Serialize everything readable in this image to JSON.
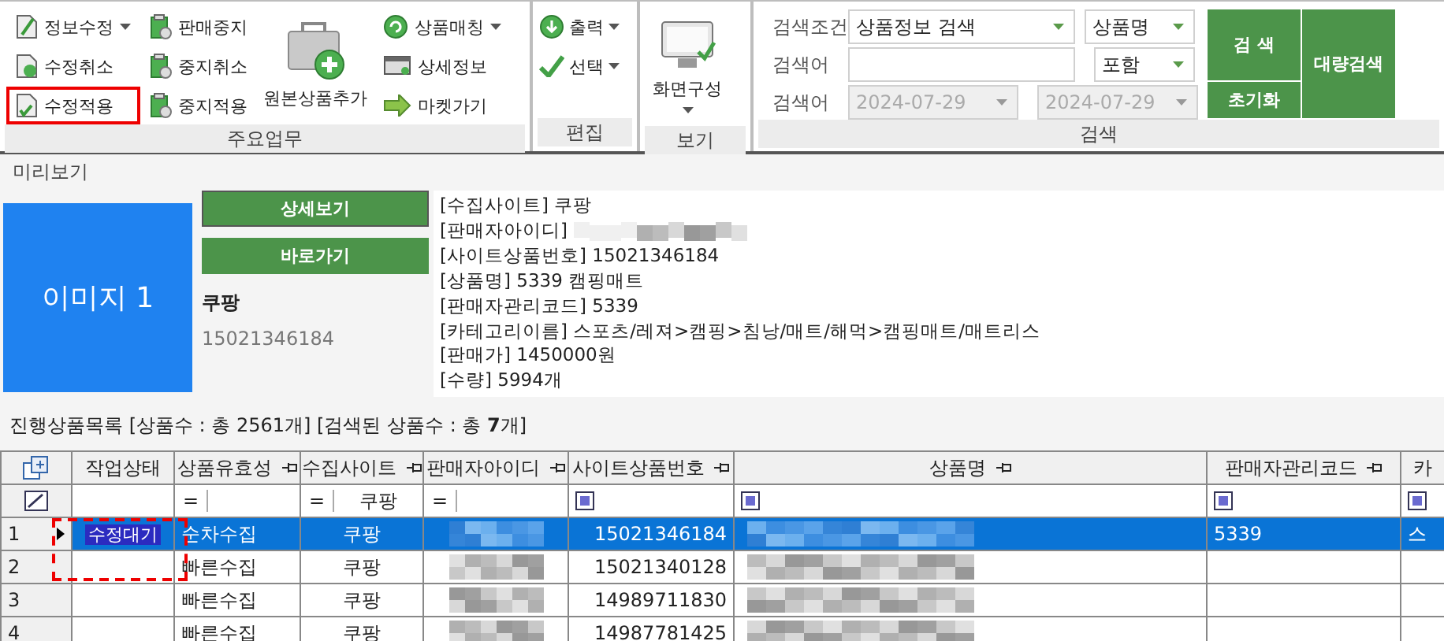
{
  "ribbon": {
    "main_tasks": {
      "label": "주요업무",
      "columns": [
        [
          {
            "label": "정보수정",
            "dropdown": true,
            "highlighted": false
          },
          {
            "label": "수정취소",
            "dropdown": false,
            "highlighted": false
          },
          {
            "label": "수정적용",
            "dropdown": false,
            "highlighted": true
          }
        ],
        [
          {
            "label": "판매중지",
            "dropdown": false,
            "highlighted": false
          },
          {
            "label": "중지취소",
            "dropdown": false,
            "highlighted": false
          },
          {
            "label": "중지적용",
            "dropdown": false,
            "highlighted": false
          }
        ],
        [
          {
            "label": "원본상품추가",
            "highlighted": false
          }
        ],
        [
          {
            "label": "상품매칭",
            "dropdown": true,
            "highlighted": false
          },
          {
            "label": "상세정보",
            "dropdown": false,
            "highlighted": false
          },
          {
            "label": "마켓가기",
            "dropdown": false,
            "highlighted": false
          }
        ]
      ]
    },
    "edit": {
      "label": "편집",
      "buttons": [
        {
          "label": "출력",
          "dropdown": true
        },
        {
          "label": "선택",
          "dropdown": true
        }
      ]
    },
    "view": {
      "label": "보기",
      "button": {
        "label": "화면구성",
        "dropdown": true
      }
    },
    "search": {
      "label": "검색",
      "condition_label": "검색조건",
      "condition": "상품정보 검색",
      "field": "상품명",
      "keyword_label": "검색어",
      "match": "포함",
      "date_label": "검색어",
      "date_from": "2024-07-29",
      "date_to": "2024-07-29",
      "dates_disabled": true,
      "search_button": "검 색",
      "reset_button": "초기화",
      "bulk_button": "대량검색"
    }
  },
  "preview": {
    "title": "미리보기",
    "image_label": "이미지 1",
    "detail_button": "상세보기",
    "goto_button": "바로가기",
    "site": "쿠팡",
    "product_no": "15021346184",
    "info": [
      "[수집사이트]  쿠팡",
      "[판매자아이디]",
      "[사이트상품번호]  15021346184",
      "[상품명]  5339 캠핑매트",
      "[판매자관리코드]  5339",
      "[카테고리이름]  스포츠/레져>캠핑>침낭/매트/해먹>캠핑매트/매트리스",
      "[판매가]  1450000원",
      "[수량]  5994개"
    ]
  },
  "list_summary": "진행상품목록  [상품수 : 총 2561개]  [검색된 상품수 : 총 **7**개]",
  "grid": {
    "columns": [
      {
        "label": "작업상태",
        "pin": false
      },
      {
        "label": "상품유효성",
        "pin": true
      },
      {
        "label": "수집사이트",
        "pin": true
      },
      {
        "label": "판매자아이디",
        "pin": true
      },
      {
        "label": "사이트상품번호",
        "pin": true
      },
      {
        "label": "상품명",
        "pin": true
      },
      {
        "label": "판매자관리코드",
        "pin": true
      },
      {
        "label": "카",
        "pin": false
      }
    ],
    "filters": [
      {
        "kind": "empty"
      },
      {
        "kind": "equals",
        "operator": "="
      },
      {
        "kind": "equals",
        "operator": "=",
        "value": "쿠팡"
      },
      {
        "kind": "equals",
        "operator": "="
      },
      {
        "kind": "check",
        "checked": true
      },
      {
        "kind": "check",
        "checked": true
      },
      {
        "kind": "check",
        "checked": true
      },
      {
        "kind": "check",
        "checked": true
      }
    ],
    "rows": [
      {
        "number": "1",
        "selected": true,
        "status": "수정대기",
        "validity": "순차수집",
        "site": "쿠팡",
        "product_no": "15021346184",
        "code": "5339",
        "category": "스"
      },
      {
        "number": "2",
        "selected": false,
        "validity": "빠른수집",
        "site": "쿠팡",
        "product_no": "15021340128"
      },
      {
        "number": "3",
        "selected": false,
        "validity": "빠른수집",
        "site": "쿠팡",
        "product_no": "14989711830"
      },
      {
        "number": "4",
        "selected": false,
        "validity": "빠른수집",
        "site": "쿠팡",
        "product_no": "14987781425"
      }
    ],
    "status_marked": true
  }
}
